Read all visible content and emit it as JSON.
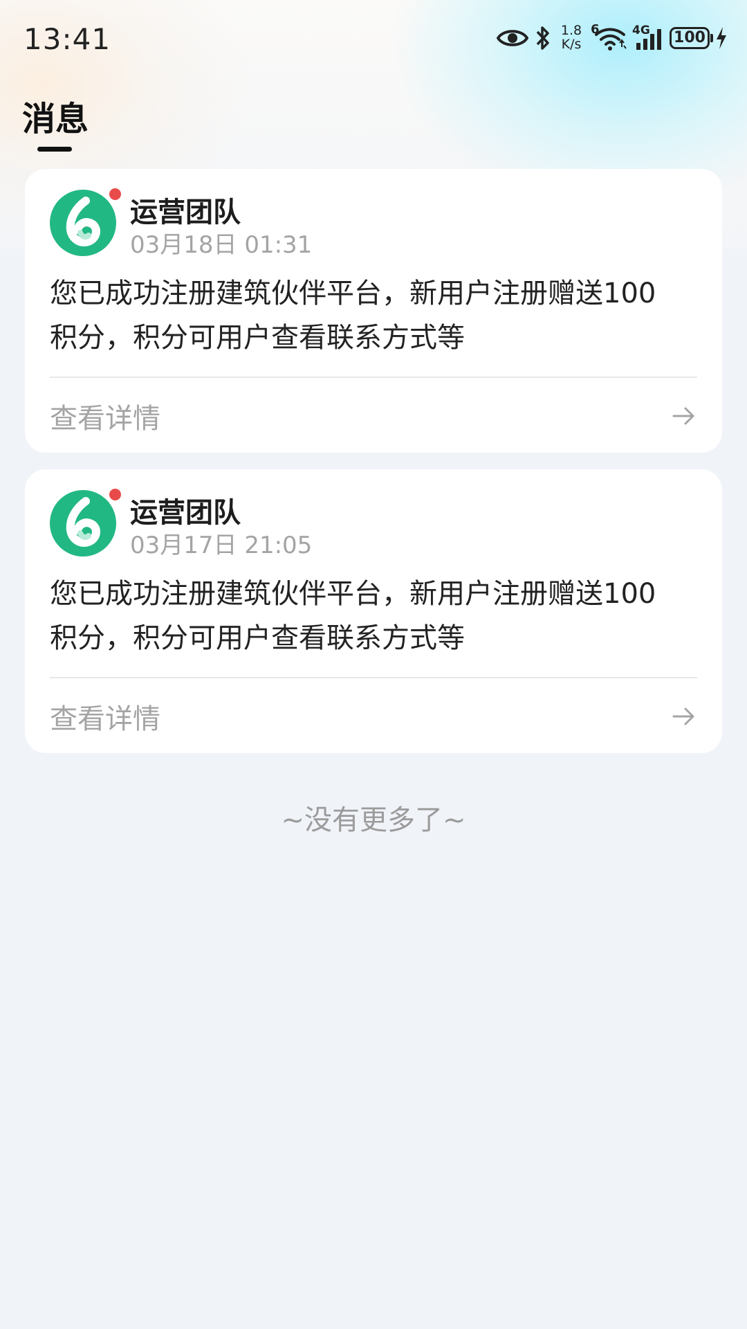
{
  "status_bar": {
    "time": "13:41",
    "net_speed_value": "1.8",
    "net_speed_unit": "K/s",
    "wifi_badge": "6",
    "cell_label": "4G",
    "battery": "100",
    "icons": [
      "eye-icon",
      "bluetooth-icon",
      "wifi-icon",
      "cellular-signal-icon",
      "battery-icon",
      "charging-icon"
    ]
  },
  "header": {
    "title": "消息"
  },
  "messages": [
    {
      "sender": "运营团队",
      "time": "03月18日 01:31",
      "line1": "您已成功注册建筑伙伴平台，新用户注册赠送100",
      "line2": "积分，积分可用户查看联系方式等",
      "detail_label": "查看详情",
      "unread": true
    },
    {
      "sender": "运营团队",
      "time": "03月17日 21:05",
      "line1": "您已成功注册建筑伙伴平台，新用户注册赠送100",
      "line2": "积分，积分可用户查看联系方式等",
      "detail_label": "查看详情",
      "unread": true
    }
  ],
  "footer": {
    "end_text": "~没有更多了~"
  },
  "colors": {
    "avatar_green": "#22b884",
    "unread_red": "#e94b4b",
    "background": "#f0f3f8"
  }
}
